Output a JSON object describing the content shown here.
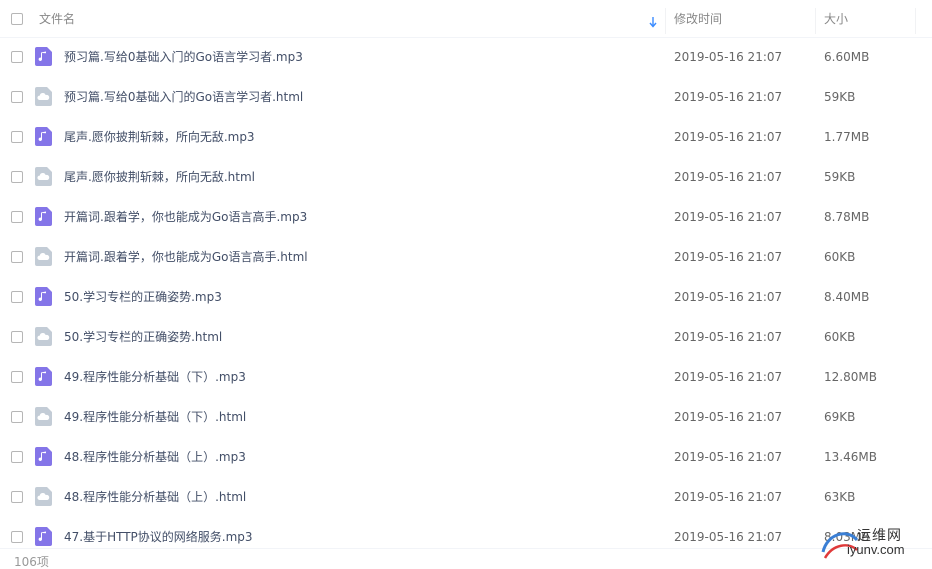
{
  "header": {
    "name_label": "文件名",
    "date_label": "修改时间",
    "size_label": "大小"
  },
  "files": [
    {
      "name": "预习篇.写给0基础入门的Go语言学习者.mp3",
      "type": "audio",
      "date": "2019-05-16 21:07",
      "size": "6.60MB"
    },
    {
      "name": "预习篇.写给0基础入门的Go语言学习者.html",
      "type": "cloud",
      "date": "2019-05-16 21:07",
      "size": "59KB"
    },
    {
      "name": "尾声.愿你披荆斩棘，所向无敌.mp3",
      "type": "audio",
      "date": "2019-05-16 21:07",
      "size": "1.77MB"
    },
    {
      "name": "尾声.愿你披荆斩棘，所向无敌.html",
      "type": "cloud",
      "date": "2019-05-16 21:07",
      "size": "59KB"
    },
    {
      "name": "开篇词.跟着学，你也能成为Go语言高手.mp3",
      "type": "audio",
      "date": "2019-05-16 21:07",
      "size": "8.78MB"
    },
    {
      "name": "开篇词.跟着学，你也能成为Go语言高手.html",
      "type": "cloud",
      "date": "2019-05-16 21:07",
      "size": "60KB"
    },
    {
      "name": "50.学习专栏的正确姿势.mp3",
      "type": "audio",
      "date": "2019-05-16 21:07",
      "size": "8.40MB"
    },
    {
      "name": "50.学习专栏的正确姿势.html",
      "type": "cloud",
      "date": "2019-05-16 21:07",
      "size": "60KB"
    },
    {
      "name": "49.程序性能分析基础（下）.mp3",
      "type": "audio",
      "date": "2019-05-16 21:07",
      "size": "12.80MB"
    },
    {
      "name": "49.程序性能分析基础（下）.html",
      "type": "cloud",
      "date": "2019-05-16 21:07",
      "size": "69KB"
    },
    {
      "name": "48.程序性能分析基础（上）.mp3",
      "type": "audio",
      "date": "2019-05-16 21:07",
      "size": "13.46MB"
    },
    {
      "name": "48.程序性能分析基础（上）.html",
      "type": "cloud",
      "date": "2019-05-16 21:07",
      "size": "63KB"
    },
    {
      "name": "47.基于HTTP协议的网络服务.mp3",
      "type": "audio",
      "date": "2019-05-16 21:07",
      "size": "8.03MB"
    }
  ],
  "footer": {
    "count": "106项"
  },
  "watermark": {
    "cn": "运维网",
    "en": "iyunv.com"
  },
  "colors": {
    "audio_icon": "#8475e8",
    "cloud_icon": "#c3ccd6",
    "sort_arrow": "#3b8cff"
  }
}
